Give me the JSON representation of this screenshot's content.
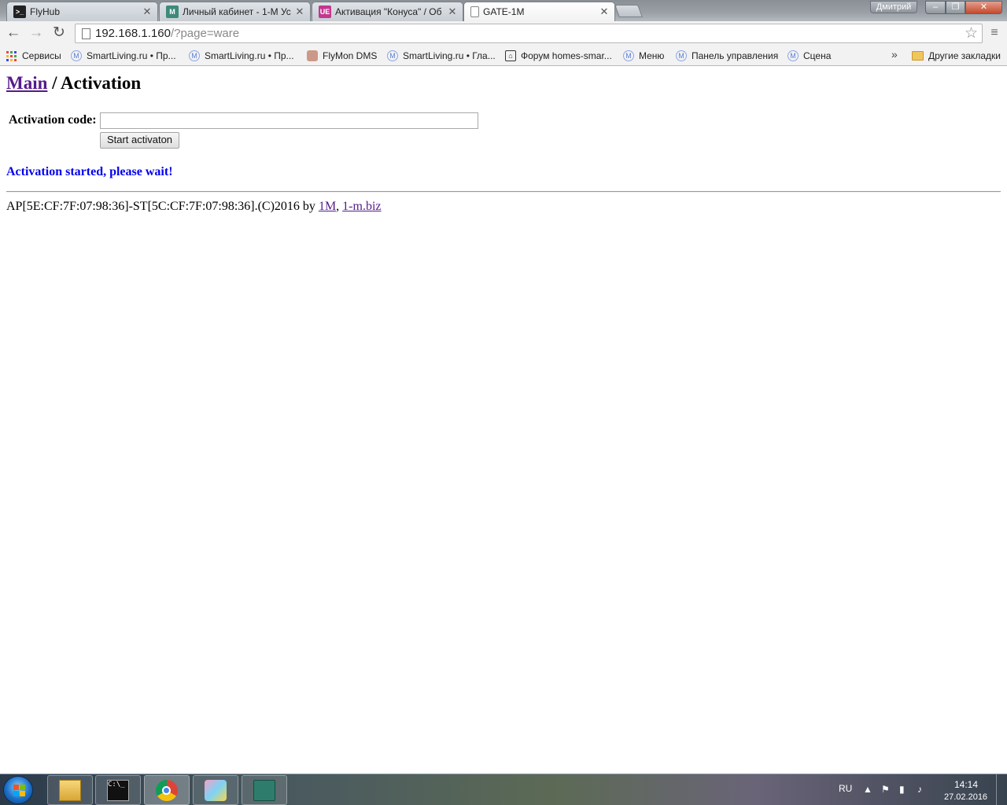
{
  "browser": {
    "tabs": [
      {
        "title": "FlyHub"
      },
      {
        "title": "Личный кабинет - 1-М Ус"
      },
      {
        "title": "Активация \"Конуса\" / Об"
      },
      {
        "title": "GATE-1M"
      }
    ],
    "user_name": "Дмитрий",
    "url_host": "192.168.1.160",
    "url_path": "/?page=ware",
    "bookmarks": [
      {
        "label": "Сервисы"
      },
      {
        "label": "SmartLiving.ru • Пр..."
      },
      {
        "label": "SmartLiving.ru • Пр..."
      },
      {
        "label": "FlyMon DMS"
      },
      {
        "label": "SmartLiving.ru • Гла..."
      },
      {
        "label": "Форум homes-smar..."
      },
      {
        "label": "Меню"
      },
      {
        "label": "Панель управления"
      },
      {
        "label": "Сцена"
      }
    ],
    "bookmarks_more": "»",
    "other_bookmarks": "Другие закладки"
  },
  "page": {
    "breadcrumb_link": "Main",
    "breadcrumb_separator": " / ",
    "title": "Activation",
    "code_label": "Activation code:",
    "code_value": "",
    "start_button": "Start activaton",
    "status_message": "Activation started, please wait!",
    "footer_text": "AP[5E:CF:7F:07:98:36]-ST[5C:CF:7F:07:98:36].(C)2016 by ",
    "footer_link_1": "1M",
    "footer_sep": ", ",
    "footer_link_2": "1-m.biz"
  },
  "taskbar": {
    "language": "RU",
    "time": "14:14",
    "date": "27.02.2016"
  },
  "colors": {
    "link_visited": "#551a8b",
    "link": "#0000ee",
    "status_text": "#0000ee"
  }
}
